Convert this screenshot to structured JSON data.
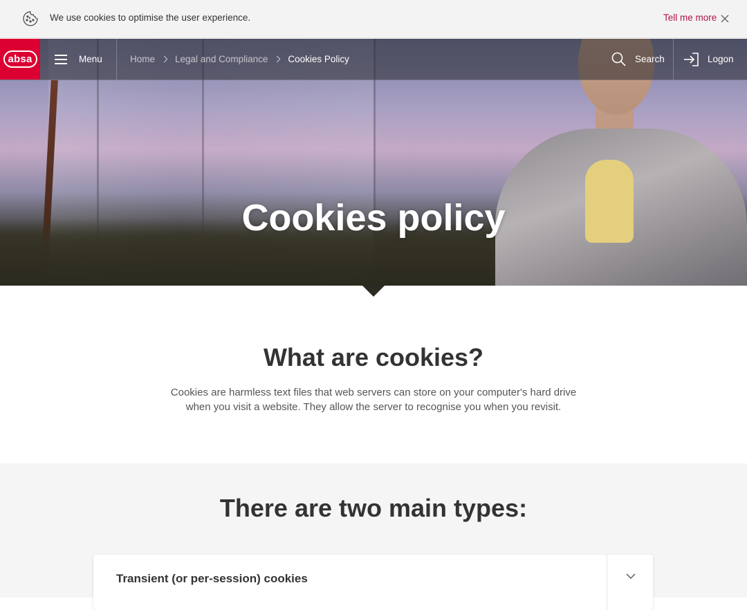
{
  "cookie_banner": {
    "message": "We use cookies to optimise the user experience.",
    "link_label": "Tell me more"
  },
  "nav": {
    "logo": "absa",
    "menu_label": "Menu",
    "breadcrumb": [
      "Home",
      "Legal and Compliance",
      "Cookies Policy"
    ],
    "search_label": "Search",
    "logon_label": "Logon"
  },
  "hero": {
    "title": "Cookies policy"
  },
  "intro": {
    "heading": "What are cookies?",
    "body": "Cookies are harmless text files that web servers can store on your computer's hard drive when you visit a website. They allow the server to recognise you when you revisit."
  },
  "types": {
    "heading": "There are two main types:",
    "accordion": [
      {
        "title": "Transient (or per-session) cookies"
      }
    ]
  },
  "colors": {
    "brand_red": "#dc0032",
    "link_crimson": "#af144b"
  }
}
